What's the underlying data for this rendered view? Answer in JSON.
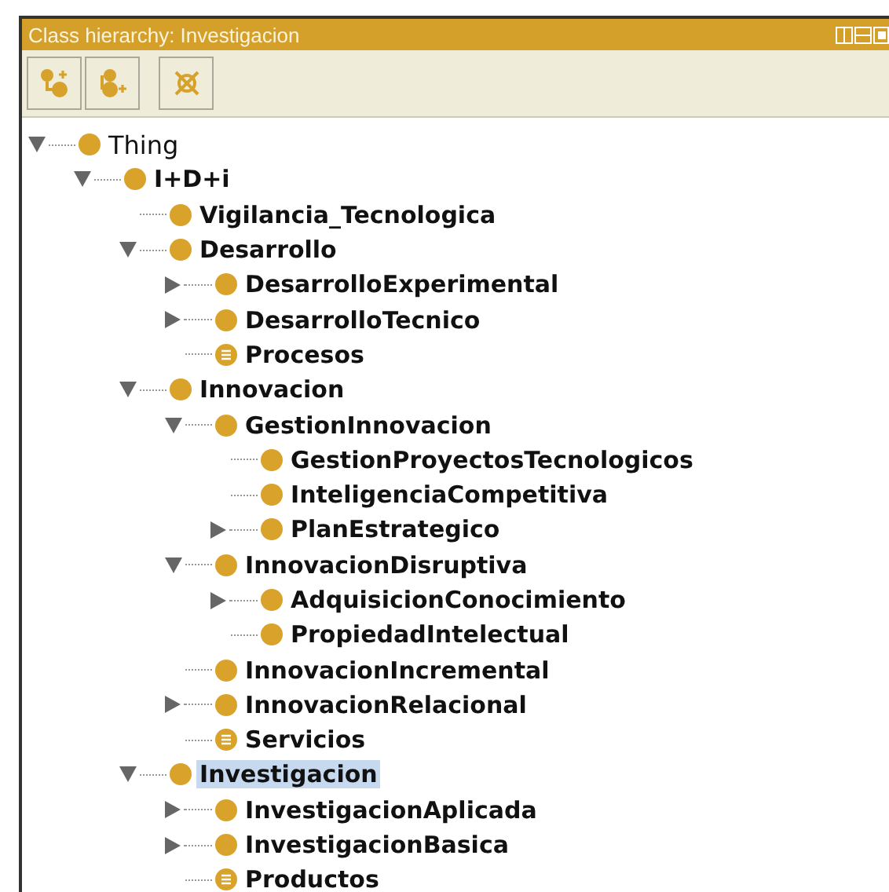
{
  "panel": {
    "title": "Class hierarchy: Investigacion"
  },
  "toolbar": [
    {
      "kind": "add-subclass"
    },
    {
      "kind": "add-sibling"
    },
    {
      "kind": "delete"
    }
  ],
  "tree": [
    {
      "label": "Thing",
      "kind": "class",
      "selected": false,
      "expanded": true,
      "children": [
        {
          "label": "I+D+i",
          "kind": "class",
          "selected": false,
          "expanded": true,
          "children": [
            {
              "label": "Vigilancia_Tecnologica",
              "kind": "class",
              "selected": false
            },
            {
              "label": "Desarrollo",
              "kind": "class",
              "selected": false,
              "expanded": true,
              "children": [
                {
                  "label": "DesarrolloExperimental",
                  "kind": "class",
                  "selected": false,
                  "expanded": false
                },
                {
                  "label": "DesarrolloTecnico",
                  "kind": "class",
                  "selected": false,
                  "expanded": false
                },
                {
                  "label": "Procesos",
                  "kind": "defined",
                  "selected": false
                }
              ]
            },
            {
              "label": "Innovacion",
              "kind": "class",
              "selected": false,
              "expanded": true,
              "children": [
                {
                  "label": "GestionInnovacion",
                  "kind": "class",
                  "selected": false,
                  "expanded": true,
                  "children": [
                    {
                      "label": "GestionProyectosTecnologicos",
                      "kind": "class",
                      "selected": false
                    },
                    {
                      "label": "InteligenciaCompetitiva",
                      "kind": "class",
                      "selected": false
                    },
                    {
                      "label": "PlanEstrategico",
                      "kind": "class",
                      "selected": false,
                      "expanded": false
                    }
                  ]
                },
                {
                  "label": "InnovacionDisruptiva",
                  "kind": "class",
                  "selected": false,
                  "expanded": true,
                  "children": [
                    {
                      "label": "AdquisicionConocimiento",
                      "kind": "class",
                      "selected": false,
                      "expanded": false
                    },
                    {
                      "label": "PropiedadIntelectual",
                      "kind": "class",
                      "selected": false
                    }
                  ]
                },
                {
                  "label": "InnovacionIncremental",
                  "kind": "class",
                  "selected": false
                },
                {
                  "label": "InnovacionRelacional",
                  "kind": "class",
                  "selected": false,
                  "expanded": false
                },
                {
                  "label": "Servicios",
                  "kind": "defined",
                  "selected": false
                }
              ]
            },
            {
              "label": "Investigacion",
              "kind": "class",
              "selected": true,
              "expanded": true,
              "children": [
                {
                  "label": "InvestigacionAplicada",
                  "kind": "class",
                  "selected": false,
                  "expanded": false
                },
                {
                  "label": "InvestigacionBasica",
                  "kind": "class",
                  "selected": false,
                  "expanded": false
                },
                {
                  "label": "Productos",
                  "kind": "defined",
                  "selected": false
                }
              ]
            }
          ]
        }
      ]
    }
  ]
}
